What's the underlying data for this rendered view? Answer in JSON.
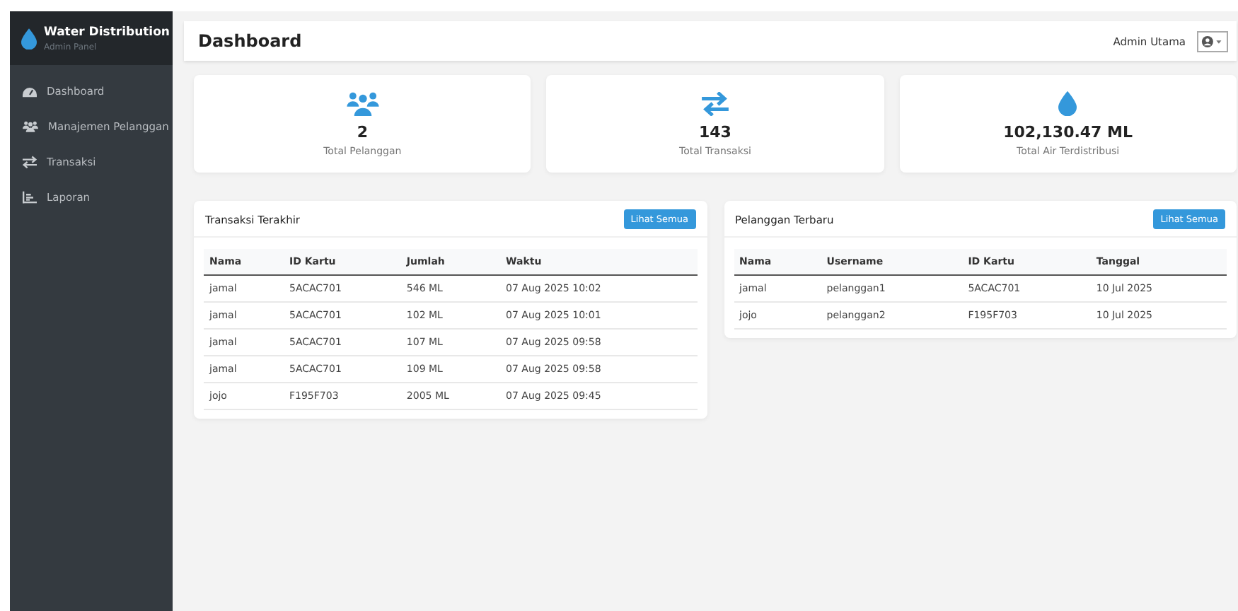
{
  "sidebar": {
    "brand": "Water Distribution",
    "subtitle": "Admin Panel",
    "items": [
      {
        "label": "Dashboard"
      },
      {
        "label": "Manajemen Pelanggan"
      },
      {
        "label": "Transaksi"
      },
      {
        "label": "Laporan"
      }
    ]
  },
  "header": {
    "title": "Dashboard",
    "user": "Admin Utama"
  },
  "stats": [
    {
      "value": "2",
      "label": "Total Pelanggan"
    },
    {
      "value": "143",
      "label": "Total Transaksi"
    },
    {
      "value": "102,130.47 ML",
      "label": "Total Air Terdistribusi"
    }
  ],
  "panels": [
    {
      "title": "Transaksi Terakhir",
      "button": "Lihat Semua",
      "columns": [
        "Nama",
        "ID Kartu",
        "Jumlah",
        "Waktu"
      ],
      "rows": [
        [
          "jamal",
          "5ACAC701",
          "546 ML",
          "07 Aug 2025 10:02"
        ],
        [
          "jamal",
          "5ACAC701",
          "102 ML",
          "07 Aug 2025 10:01"
        ],
        [
          "jamal",
          "5ACAC701",
          "107 ML",
          "07 Aug 2025 09:58"
        ],
        [
          "jamal",
          "5ACAC701",
          "109 ML",
          "07 Aug 2025 09:58"
        ],
        [
          "jojo",
          "F195F703",
          "2005 ML",
          "07 Aug 2025 09:45"
        ]
      ]
    },
    {
      "title": "Pelanggan Terbaru",
      "button": "Lihat Semua",
      "columns": [
        "Nama",
        "Username",
        "ID Kartu",
        "Tanggal"
      ],
      "rows": [
        [
          "jamal",
          "pelanggan1",
          "5ACAC701",
          "10 Jul 2025"
        ],
        [
          "jojo",
          "pelanggan2",
          "F195F703",
          "10 Jul 2025"
        ]
      ]
    }
  ]
}
